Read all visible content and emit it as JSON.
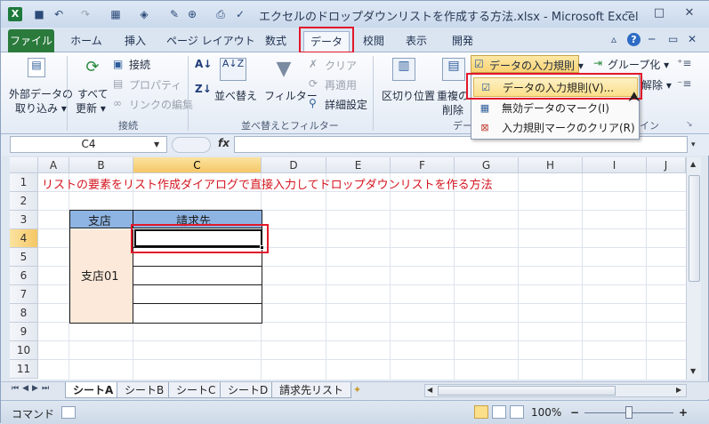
{
  "window": {
    "title": "エクセルのドロップダウンリストを作成する方法.xlsx - Microsoft Excel",
    "app_icon": "X",
    "minimize": "─",
    "maximize": "□",
    "close": "✕"
  },
  "tabs": [
    {
      "label": "ファイル"
    },
    {
      "label": "ホーム"
    },
    {
      "label": "挿入"
    },
    {
      "label": "ページ レイアウト"
    },
    {
      "label": "数式"
    },
    {
      "label": "データ"
    },
    {
      "label": "校閲"
    },
    {
      "label": "表示"
    },
    {
      "label": "開発"
    }
  ],
  "ribbon": {
    "external_data": {
      "line1": "外部データの",
      "line2": "取り込み ▾"
    },
    "refresh": {
      "line1": "すべて",
      "line2": "更新 ▾"
    },
    "connections": [
      "接続",
      "プロパティ",
      "リンクの編集"
    ],
    "connections_group": "接続",
    "sort_asc": "A↓Z",
    "sort": "並べ替え",
    "filter": "フィルター",
    "filter_options": [
      "クリア",
      "再適用",
      "詳細設定"
    ],
    "sort_filter_group": "並べ替えとフィルター",
    "text_to_columns": "区切り位置",
    "remove_duplicates": {
      "line1": "重複の",
      "line2": "削除"
    },
    "data_tools_group": "デー",
    "data_validation": "データの入力規則 ▾",
    "group": "グループ化 ▾",
    "ungroup": "解除 ▾",
    "outline_group": "イン"
  },
  "menu": {
    "items": [
      {
        "label": "データの入力規則(V)..."
      },
      {
        "label": "無効データのマーク(I)"
      },
      {
        "label": "入力規則マークのクリア(R)"
      }
    ]
  },
  "formula_bar": {
    "name_box": "C4",
    "fx": "fx",
    "value": ""
  },
  "grid": {
    "columns": [
      "A",
      "B",
      "C",
      "D",
      "E",
      "F",
      "G",
      "H",
      "I",
      "J"
    ],
    "rows": [
      "1",
      "2",
      "3",
      "4",
      "5",
      "6",
      "7",
      "8",
      "9",
      "10",
      "11"
    ],
    "title_text": "リストの要素をリスト作成ダイアログで直接入力してドロップダウンリストを作る方法",
    "header_shiten": "支店",
    "header_seikyu": "請求先",
    "branch_value": "支店01"
  },
  "sheets": [
    {
      "label": "シートA"
    },
    {
      "label": "シートB"
    },
    {
      "label": "シートC"
    },
    {
      "label": "シートD"
    },
    {
      "label": "請求先リスト"
    }
  ],
  "status": {
    "mode": "コマンド",
    "zoom": "100%",
    "zoom_minus": "−",
    "zoom_plus": "+"
  },
  "colors": {
    "file_tab": "#2a7a3c",
    "highlight_red": "#e2182a",
    "title_text_red": "#d4151f",
    "table_header_blue": "#8eb4e3",
    "table_body_peach": "#fde9d9"
  }
}
